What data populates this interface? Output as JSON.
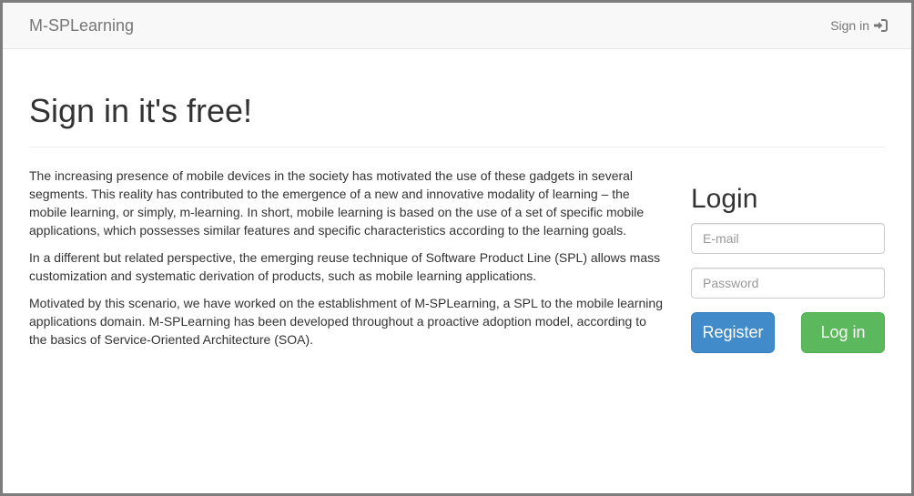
{
  "navbar": {
    "brand": "M-SPLearning",
    "signin_label": "Sign in",
    "signin_icon": "sign-in-icon"
  },
  "main": {
    "title": "Sign in it's free!",
    "paragraphs": [
      "The increasing presence of mobile devices in the society has motivated the use of these gadgets in several segments. This reality has contributed to the emergence of a new and innovative modality of learning – the mobile learning, or simply, m-learning. In short, mobile learning is based on the use of a set of specific mobile applications, which possesses similar features and specific characteristics according to the learning goals.",
      "In a different but related perspective, the emerging reuse technique of Software Product Line (SPL) allows mass customization and systematic derivation of products, such as mobile learning applications.",
      "Motivated by this scenario, we have worked on the establishment of M-SPLearning, a SPL to the mobile learning applications domain. M-SPLearning has been developed throughout a proactive adoption model, according to the basics of Service-Oriented Architecture (SOA)."
    ]
  },
  "login": {
    "title": "Login",
    "email_placeholder": "E-mail",
    "email_value": "",
    "password_placeholder": "Password",
    "password_value": "",
    "register_label": "Register",
    "login_label": "Log in"
  },
  "colors": {
    "navbar_bg": "#f8f8f8",
    "register_bg": "#428bca",
    "login_bg": "#5cb85c",
    "muted_text": "#777777"
  }
}
